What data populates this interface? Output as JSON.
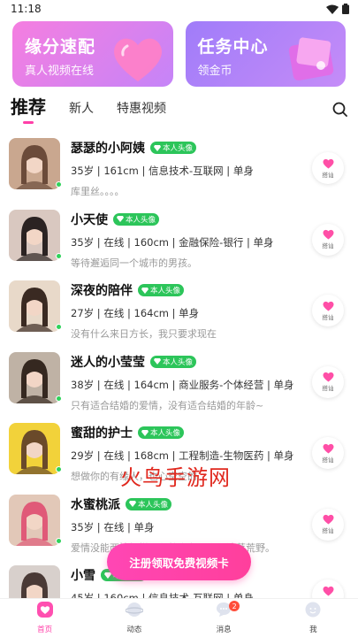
{
  "status_bar": {
    "time": "11:18"
  },
  "banners": [
    {
      "title": "缘分速配",
      "subtitle": "真人视频在线"
    },
    {
      "title": "任务中心",
      "subtitle": "领金币"
    }
  ],
  "tabs": [
    {
      "label": "推荐",
      "active": true
    },
    {
      "label": "新人",
      "active": false
    },
    {
      "label": "特惠视频",
      "active": false
    }
  ],
  "verify_label": "本人头像",
  "greet_label": "搭讪",
  "users": [
    {
      "name": "瑟瑟的小阿姨",
      "meta": "35岁 | 161cm | 信息技术-互联网 | 单身",
      "desc": "库里丝。。。。",
      "avatar_colors": [
        "#c9a78f",
        "#6b4b3a"
      ]
    },
    {
      "name": "小天使",
      "meta": "35岁 | 在线 | 160cm | 金融保险-银行 | 单身",
      "desc": "等待邂逅同一个城市的男孩。",
      "avatar_colors": [
        "#d9c8c0",
        "#2b2322"
      ]
    },
    {
      "name": "深夜的陪伴",
      "meta": "27岁 | 在线 | 164cm | 单身",
      "desc": "没有什么来日方长，我只要求现在",
      "avatar_colors": [
        "#e8d9c9",
        "#3a2a22"
      ]
    },
    {
      "name": "迷人的小莹莹",
      "meta": "38岁 | 在线 | 164cm | 商业服务-个体经营 | 单身",
      "desc": "只有适合结婚的爱情，没有适合结婚的年龄~",
      "avatar_colors": [
        "#bfb2a5",
        "#352820"
      ]
    },
    {
      "name": "蜜甜的护士",
      "meta": "29岁 | 在线 | 168cm | 工程制造-生物医药 | 单身",
      "desc": "想做你的有缘人，也心空空的",
      "avatar_colors": [
        "#f2d23a",
        "#6a4a2a"
      ]
    },
    {
      "name": "水蜜桃派",
      "meta": "35岁 | 在线 | 单身",
      "desc": "爱情没能两情相悦，必然会有一个人沦落荒野。",
      "avatar_colors": [
        "#e2c8b8",
        "#e05a78"
      ]
    },
    {
      "name": "小雪",
      "meta": "45岁 | 160cm | 信息技术-互联网 | 单身",
      "desc": "",
      "avatar_colors": [
        "#d8d0cc",
        "#4a3a36"
      ]
    }
  ],
  "watermark": "火鸟手游网",
  "cta": {
    "label": "注册领取免费视频卡"
  },
  "bottom_nav": [
    {
      "label": "首页",
      "active": true,
      "icon": "home-icon"
    },
    {
      "label": "动态",
      "active": false,
      "icon": "planet-icon"
    },
    {
      "label": "消息",
      "active": false,
      "icon": "message-icon",
      "badge": "2"
    },
    {
      "label": "我",
      "active": false,
      "icon": "profile-icon"
    }
  ],
  "colors": {
    "accent": "#ff3fa8",
    "online": "#2fd25a",
    "verify": "#2cc55a"
  }
}
